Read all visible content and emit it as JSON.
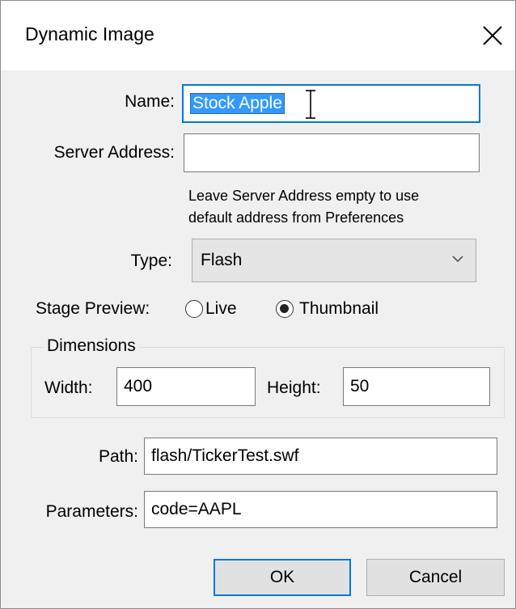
{
  "window": {
    "title": "Dynamic Image"
  },
  "name": {
    "label": "Name:",
    "value": "Stock Apple"
  },
  "server": {
    "label": "Server Address:",
    "value": "",
    "hint_line1": "Leave Server Address empty to use",
    "hint_line2": "default address from Preferences"
  },
  "type": {
    "label": "Type:",
    "value": "Flash"
  },
  "stage_preview": {
    "label": "Stage Preview:",
    "options": [
      "Live",
      "Thumbnail"
    ],
    "selected": "Thumbnail"
  },
  "dimensions": {
    "group_label": "Dimensions",
    "width_label": "Width:",
    "width_value": "400",
    "height_label": "Height:",
    "height_value": "50"
  },
  "path": {
    "label": "Path:",
    "value": "flash/TickerTest.swf"
  },
  "parameters": {
    "label": "Parameters:",
    "value": "code=AAPL"
  },
  "buttons": {
    "ok": "OK",
    "cancel": "Cancel"
  },
  "colors": {
    "focus": "#0078d7",
    "selection": "#3399ff",
    "dialog_bg": "#f0f0f0"
  }
}
